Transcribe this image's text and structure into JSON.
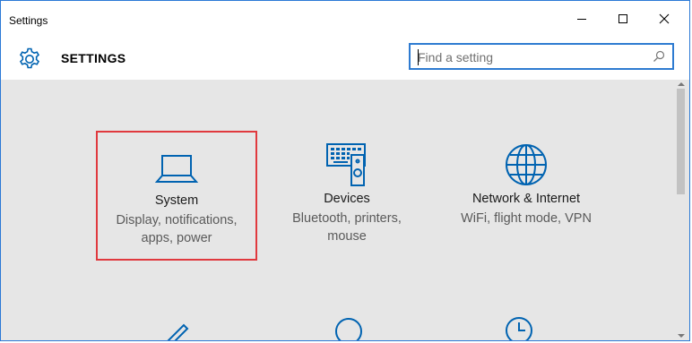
{
  "window": {
    "title": "Settings",
    "minimize_label": "Minimize",
    "maximize_label": "Maximize",
    "close_label": "Close"
  },
  "header": {
    "heading": "SETTINGS",
    "search_placeholder": "Find a setting"
  },
  "tiles": [
    {
      "title": "System",
      "desc_line1": "Display, notifications,",
      "desc_line2": "apps, power",
      "icon": "laptop-icon",
      "selected": true
    },
    {
      "title": "Devices",
      "desc_line1": "Bluetooth, printers,",
      "desc_line2": "mouse",
      "icon": "devices-icon",
      "selected": false
    },
    {
      "title": "Network & Internet",
      "desc_line1": "WiFi, flight mode, VPN",
      "desc_line2": "",
      "icon": "globe-icon",
      "selected": false
    }
  ],
  "colors": {
    "accent": "#0063b1",
    "selection": "#e0393e",
    "search_border": "#2e7bd1"
  }
}
